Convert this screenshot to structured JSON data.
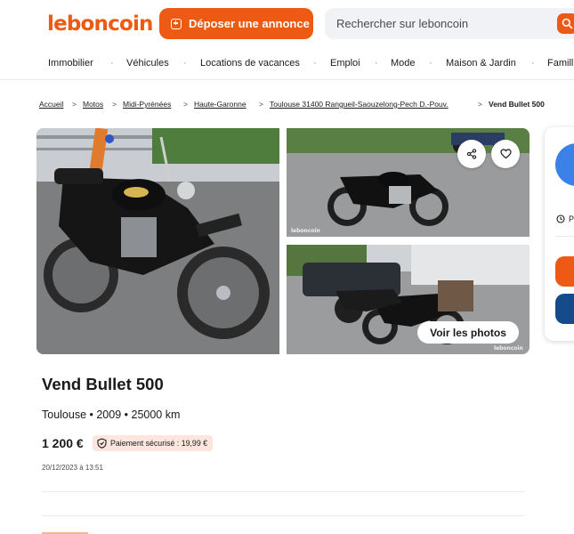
{
  "header": {
    "logo_text": "leboncoin",
    "post_button_label": "Déposer une annonce",
    "search_placeholder": "Rechercher sur leboncoin",
    "brand_color": "#ec5a13"
  },
  "nav": {
    "items": [
      "Immobilier",
      "Véhicules",
      "Locations de vacances",
      "Emploi",
      "Mode",
      "Maison & Jardin",
      "Famill"
    ]
  },
  "breadcrumb": {
    "items": [
      "Accueil",
      "Motos",
      "Midi-Pyrénées",
      "Haute-Garonne",
      "Toulouse 31400 Rangueil-Saouzelong-Pech D.-Pouv."
    ],
    "current": "Vend Bullet 500"
  },
  "gallery": {
    "see_photos_label": "Voir les photos",
    "watermark": "leboncoin",
    "share_icon": "share-icon",
    "favorite_icon": "heart-icon"
  },
  "ad": {
    "title": "Vend Bullet 500",
    "meta": "Toulouse • 2009 • 25000 km",
    "price": "1 200 €",
    "secure_payment": "Paiement sécurisé : 19,99 €",
    "date": "20/12/2023 à 13:51"
  },
  "side_card": {
    "status_prefix": "P",
    "avatar_color": "#3b82e8",
    "primary_btn_color": "#ec5a13",
    "secondary_btn_color": "#154b8a"
  }
}
